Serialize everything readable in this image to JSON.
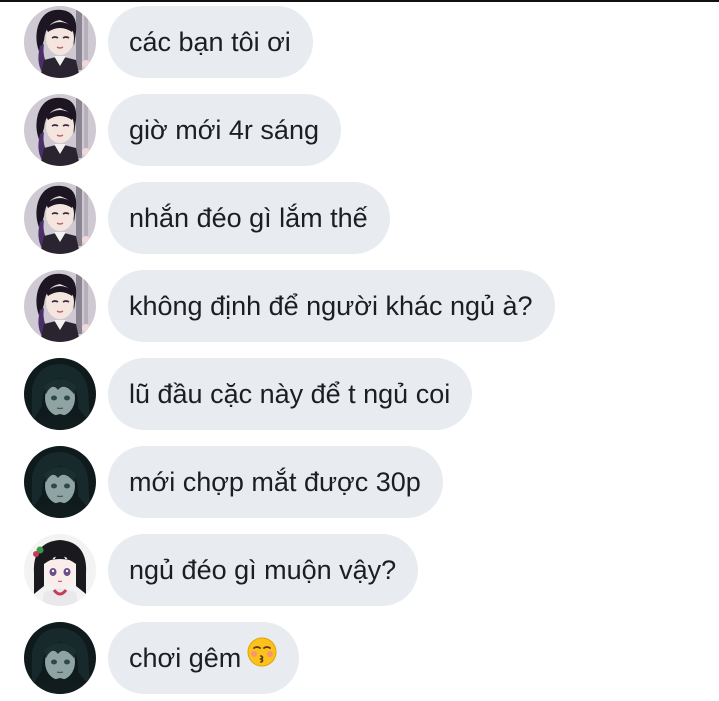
{
  "messages": [
    {
      "avatar": "avatar-purple-hair",
      "text": "các bạn tôi ơi"
    },
    {
      "avatar": "avatar-purple-hair",
      "text": "giờ mới 4r sáng"
    },
    {
      "avatar": "avatar-purple-hair",
      "text": "nhắn đéo gì lắm thế"
    },
    {
      "avatar": "avatar-purple-hair",
      "text": "không định để người khác ngủ à?"
    },
    {
      "avatar": "avatar-dark-teal-hair",
      "text": "lũ đầu cặc này để t ngủ coi"
    },
    {
      "avatar": "avatar-dark-teal-hair",
      "text": "mới chợp mắt được 30p"
    },
    {
      "avatar": "avatar-black-hair-girl",
      "text": "ngủ đéo gì muộn vậy?"
    },
    {
      "avatar": "avatar-dark-teal-hair",
      "text": "chơi gêm",
      "emoji": "kissing-face-emoji"
    }
  ],
  "colors": {
    "bubble": "#e8ebef",
    "text": "#1c1e21",
    "background": "#ffffff"
  }
}
